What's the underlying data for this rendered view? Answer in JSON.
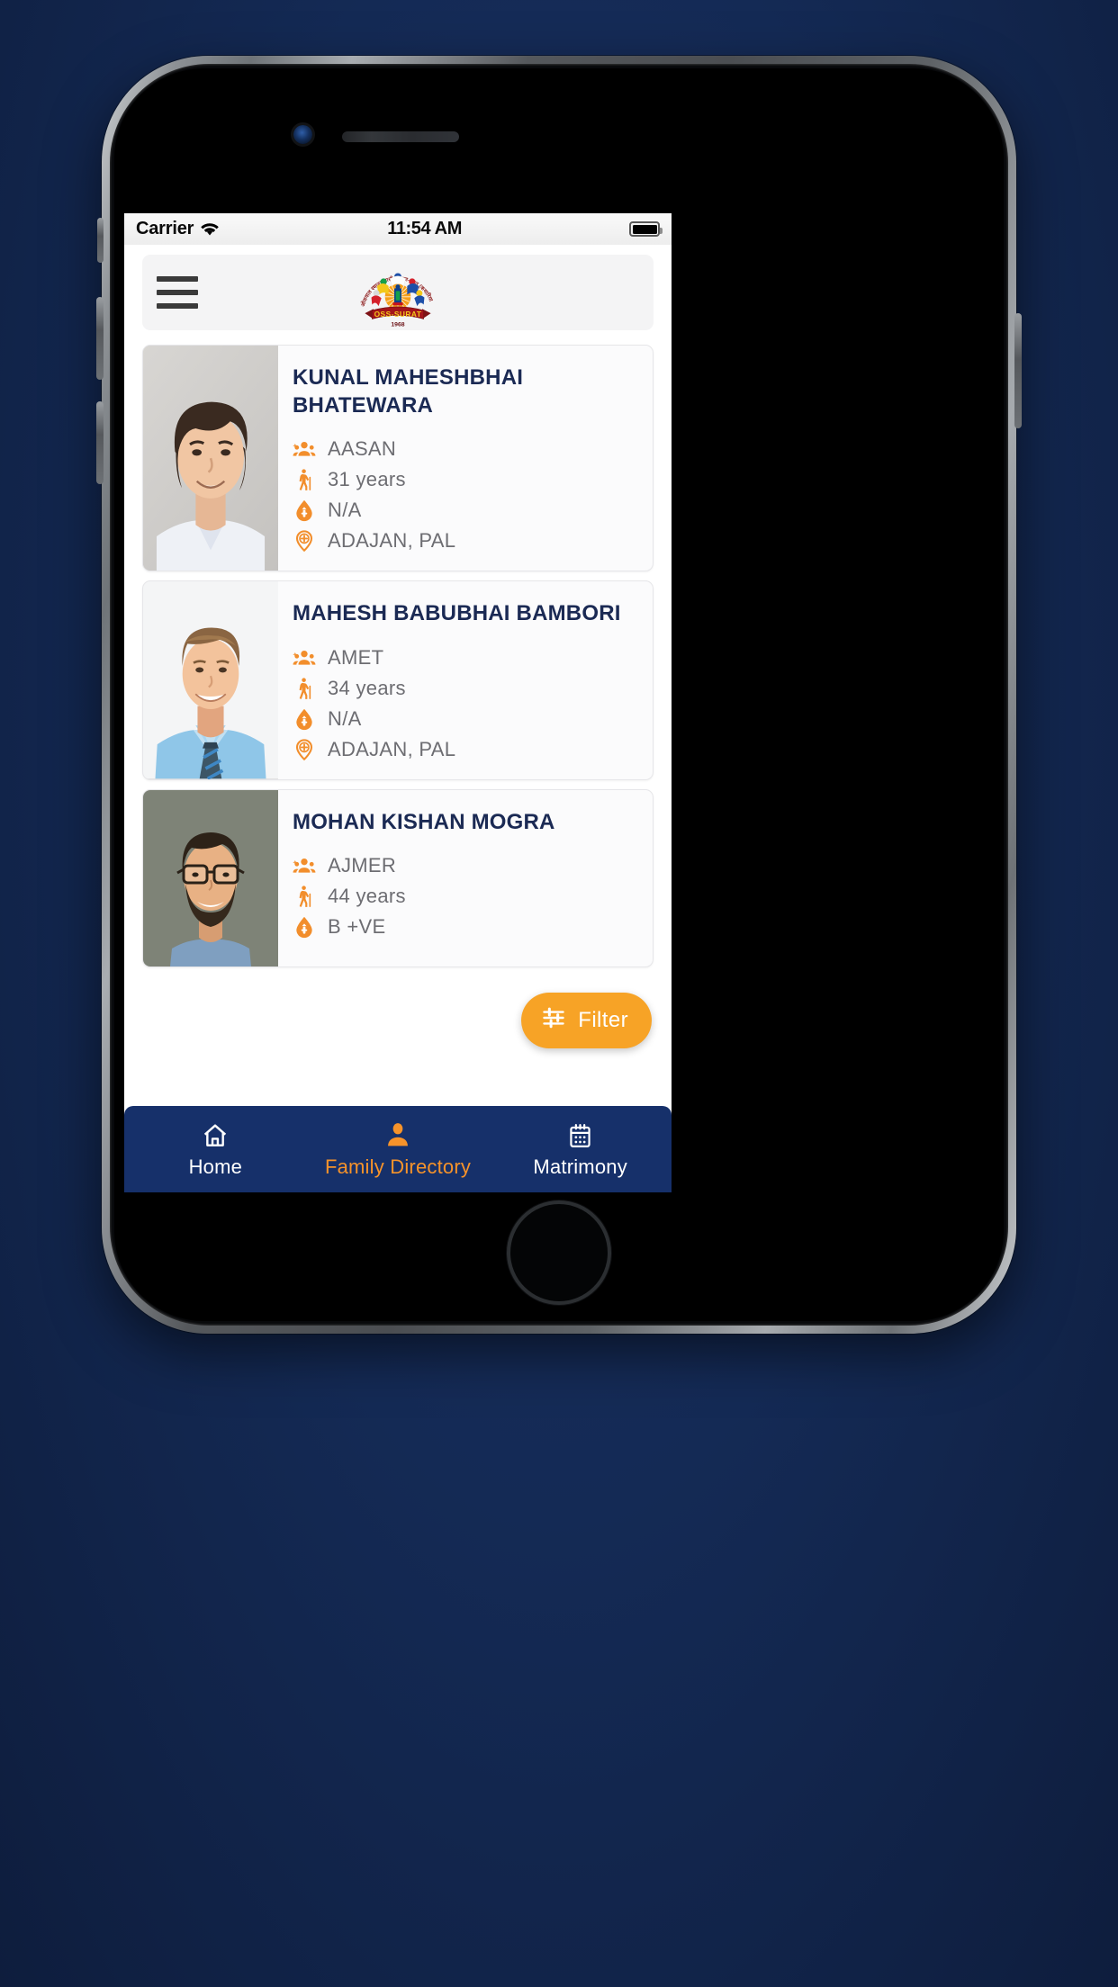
{
  "device": {
    "name": "iphone-8-simulator",
    "frame_color": "#6f7478",
    "wallpaper_color": "#13264f"
  },
  "statusbar": {
    "carrier": "Carrier",
    "wifi_icon": "wifi-icon",
    "time": "11:54 AM",
    "battery_icon": "battery-full-icon",
    "battery_level": "100"
  },
  "appbar": {
    "menu_icon": "hamburger-menu-icon",
    "logo": {
      "icon": "oss-surat-logo",
      "banner_text": "OSS-SURAT",
      "year": "1968",
      "hindi_text": "श्री ओसवाल स्थानकवासी समाज - सूरत (कथारिया केन्द्र)"
    }
  },
  "main": {
    "cards": [
      {
        "photo": "portrait-young-man-dark-hair",
        "name": "KUNAL MAHESHBHAI BHATEWARA",
        "attributes": [
          {
            "icon": "group-people-icon",
            "label": "AASAN"
          },
          {
            "icon": "elderly-person-icon",
            "label": "31 years"
          },
          {
            "icon": "blood-drop-icon",
            "label": "N/A"
          },
          {
            "icon": "location-pin-icon",
            "label": "ADAJAN, PAL"
          }
        ]
      },
      {
        "photo": "portrait-man-blue-shirt-tie",
        "name": "MAHESH BABUBHAI BAMBORI",
        "attributes": [
          {
            "icon": "group-people-icon",
            "label": "AMET"
          },
          {
            "icon": "elderly-person-icon",
            "label": "34 years"
          },
          {
            "icon": "blood-drop-icon",
            "label": "N/A"
          },
          {
            "icon": "location-pin-icon",
            "label": "ADAJAN, PAL"
          }
        ]
      },
      {
        "photo": "portrait-man-glasses-beard",
        "name": "MOHAN KISHAN MOGRA",
        "attributes": [
          {
            "icon": "group-people-icon",
            "label": "AJMER"
          },
          {
            "icon": "elderly-person-icon",
            "label": "44 years"
          },
          {
            "icon": "blood-drop-icon",
            "label": "B +VE"
          }
        ]
      }
    ]
  },
  "filter": {
    "label": "Filter",
    "icon": "sliders-filter-icon",
    "color": "#f7a326"
  },
  "bottomnav": {
    "background": "#16306a",
    "active_color": "#f7932a",
    "items": [
      {
        "icon": "home-icon",
        "label": "Home",
        "active": false
      },
      {
        "icon": "person-icon",
        "label": "Family Directory",
        "active": true
      },
      {
        "icon": "calendar-icon",
        "label": "Matrimony",
        "active": false
      }
    ]
  }
}
